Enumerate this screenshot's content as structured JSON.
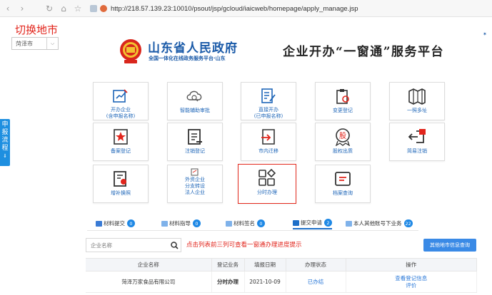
{
  "browser": {
    "url": "http://218.57.139.23:10010/psout/jsp/gcloud/iaicweb/homepage/apply_manage.jsp"
  },
  "city": {
    "hint": "切换地市",
    "selected": "菏泽市"
  },
  "header": {
    "gov_title": "山东省人民政府",
    "gov_subtitle": "全国一体化在线政务服务平台·山东",
    "portal_title": "企业开办“一窗通”服务平台"
  },
  "side_tab": {
    "label": "申报流程"
  },
  "tiles": [
    {
      "label": "开办企业\n(含申报名称)",
      "icon": "form-edit-icon"
    },
    {
      "label": "智能辅助审批",
      "icon": "cloud-search-icon"
    },
    {
      "label": "直接开办\n(已申报名称)",
      "icon": "doc-edit-icon"
    },
    {
      "label": "变更登记",
      "icon": "clipboard-refresh-icon"
    },
    {
      "label": "一照多址",
      "icon": "map-icon"
    },
    {
      "label": "备案登记",
      "icon": "star-doc-icon"
    },
    {
      "label": "注销登记",
      "icon": "doc-cancel-icon"
    },
    {
      "label": "市内迁移",
      "icon": "move-in-icon"
    },
    {
      "label": "股权出质",
      "icon": "stock-icon"
    },
    {
      "label": "简易注销",
      "icon": "simple-cancel-icon"
    },
    {
      "label": "增补换照",
      "icon": "license-icon"
    },
    {
      "label": "外资企业\n分支转设\n法人企业",
      "icon": "foreign-icon"
    },
    {
      "label": "分时办理",
      "icon": "grid-apps-icon"
    },
    {
      "label": "档案查询",
      "icon": "archive-icon"
    }
  ],
  "tabs": [
    {
      "label": "材料提交",
      "count": "0"
    },
    {
      "label": "材料指导",
      "count": "0"
    },
    {
      "label": "材料签名",
      "count": "0"
    },
    {
      "label": "提交申请",
      "count": "2"
    },
    {
      "label": "本人其他账号下业务",
      "count": "22"
    }
  ],
  "search": {
    "placeholder": "企业名称",
    "hint": "点击列表前三列可查看一窗通办理进度提示",
    "other_city_button": "其他地市信息查询"
  },
  "table": {
    "headers": [
      "企业名称",
      "登记业务",
      "填报日期",
      "办理状态",
      "操作"
    ],
    "rows": [
      {
        "company": "菏泽万家食品有限公司",
        "business": "分时办理",
        "date": "2021-10-09",
        "status": "已办结",
        "op1": "查看登记信息",
        "op2": "评价"
      }
    ]
  },
  "colors": {
    "brand_blue": "#1a5aa8",
    "accent_red": "#e2251c",
    "tab_badge": "#1e88e5"
  }
}
